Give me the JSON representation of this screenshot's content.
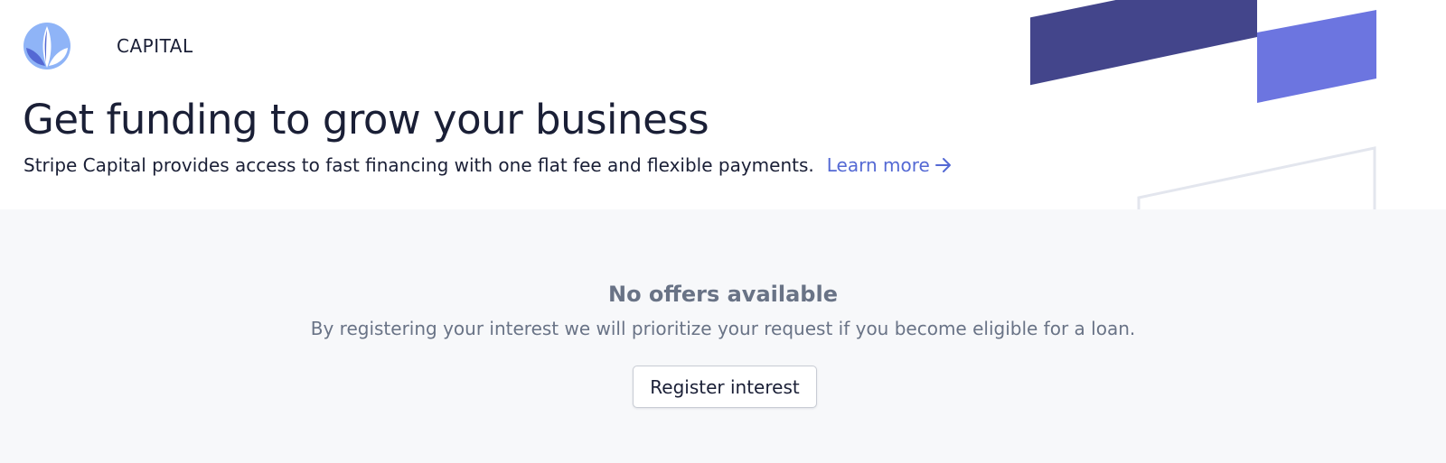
{
  "brand": {
    "name": "CAPITAL",
    "logo_icon": "capital-leaf-icon",
    "logo_colors": [
      "#8fb4f7",
      "#5469d4",
      "#ffffff"
    ]
  },
  "hero": {
    "title": "Get funding to grow your business",
    "description": "Stripe Capital provides access to fast financing with one flat fee and flexible payments.",
    "learn_more_label": "Learn more",
    "learn_more_icon": "arrow-right-icon"
  },
  "decor": {
    "colors": [
      "#43458b",
      "#6c75e0",
      "#e3e6ee"
    ]
  },
  "empty_state": {
    "title": "No offers available",
    "description": "By registering your interest we will prioritize your request if you become eligible for a loan.",
    "button_label": "Register interest"
  },
  "colors": {
    "text_primary": "#1a1f36",
    "text_secondary": "#697386",
    "accent": "#5469d4",
    "panel_background": "#f7f8fa"
  }
}
